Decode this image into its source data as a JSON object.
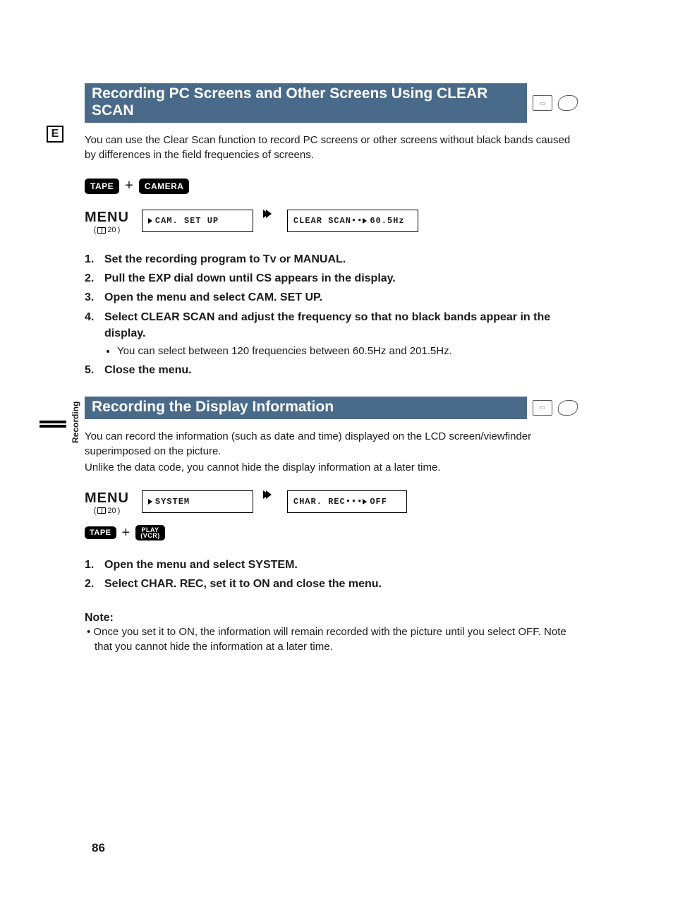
{
  "side_letter": "E",
  "recording_tab": "Recording",
  "page_number": "86",
  "section1": {
    "title": "Recording PC Screens and Other Screens Using CLEAR SCAN",
    "intro": "You can use the Clear Scan function to record PC screens or other screens without black bands caused by differences in the field frequencies of screens.",
    "pill_tape": "TAPE",
    "pill_camera": "CAMERA",
    "menu_label": "MENU",
    "menu_page": "20",
    "box1": "CAM. SET UP",
    "box2_left": "CLEAR SCAN",
    "box2_right": "60.5Hz",
    "steps": [
      "Set the recording program to Tv or MANUAL.",
      "Pull the EXP dial down until CS appears in the display.",
      "Open the menu and select CAM. SET UP.",
      "Select CLEAR SCAN and adjust the frequency so that no black bands appear in the display.",
      "Close the menu."
    ],
    "step4_bullet": "You can select between 120 frequencies between 60.5Hz and 201.5Hz."
  },
  "section2": {
    "title": "Recording the Display Information",
    "intro1": "You can record the information (such as date and time) displayed on the LCD screen/viewfinder superimposed on the picture.",
    "intro2": "Unlike the data code, you cannot hide the display information at a later time.",
    "menu_label": "MENU",
    "menu_page": "20",
    "box1": "SYSTEM",
    "box2_left": "CHAR. REC",
    "box2_right": "OFF",
    "pill_tape": "TAPE",
    "pill_play_top": "PLAY",
    "pill_play_bot": "(VCR)",
    "steps": [
      "Open the menu and select SYSTEM.",
      "Select CHAR. REC, set it to ON and close the menu."
    ],
    "note_head": "Note:",
    "note_body": "• Once you set it to ON, the information will remain recorded with the picture until you select OFF. Note that you cannot hide the information at a later time."
  }
}
